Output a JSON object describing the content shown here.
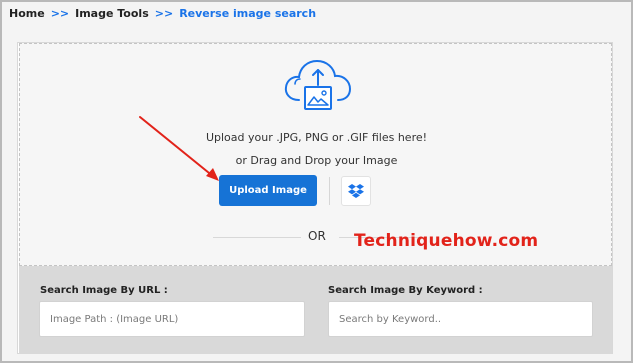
{
  "breadcrumb": {
    "home": "Home",
    "sep1": ">>",
    "section": "Image Tools",
    "sep2": ">>",
    "current": "Reverse image search"
  },
  "upload": {
    "formats_text": "Upload your .JPG, PNG or .GIF files here!",
    "drag_text": "or Drag and Drop your Image",
    "button_label": "Upload Image",
    "dropbox_icon": "dropbox-icon",
    "cloud_icon": "cloud-upload-icon"
  },
  "divider": {
    "or_text": "OR"
  },
  "watermark": "Techniquehow.com",
  "search": {
    "url_label": "Search Image By URL :",
    "url_placeholder": "Image Path : (Image URL)",
    "keyword_label": "Search Image By Keyword :",
    "keyword_placeholder": "Search by Keyword.."
  },
  "colors": {
    "accent": "#1673d6",
    "link": "#1a73e8",
    "watermark": "#e2231a"
  }
}
